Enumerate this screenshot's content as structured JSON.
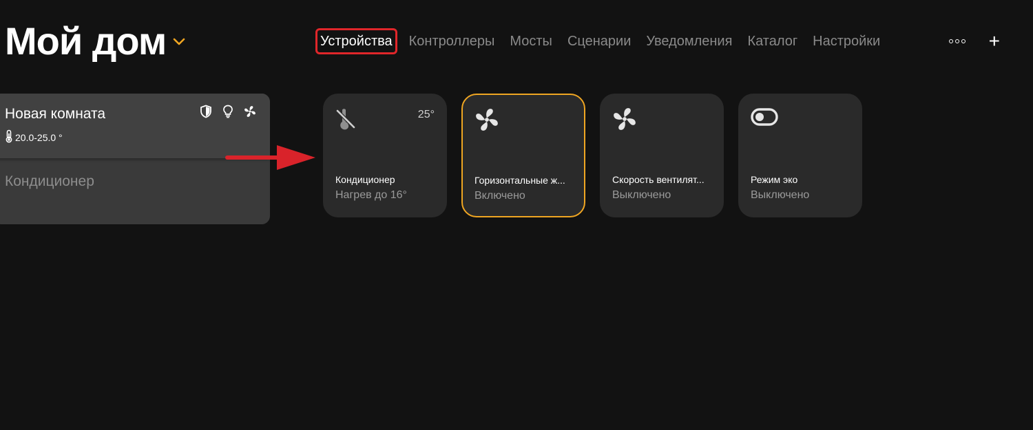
{
  "header": {
    "home_title": "Мой дом",
    "tabs": [
      {
        "label": "Устройства",
        "active": true
      },
      {
        "label": "Контроллеры"
      },
      {
        "label": "Мосты"
      },
      {
        "label": "Сценарии"
      },
      {
        "label": "Уведомления"
      },
      {
        "label": "Каталог"
      },
      {
        "label": "Настройки"
      }
    ],
    "plus_label": "+"
  },
  "room": {
    "name": "Новая комната",
    "temp_range": "20.0-25.0 °",
    "device_name": "Кондиционер",
    "icons": [
      "shield-icon",
      "bulb-icon",
      "fan-icon"
    ]
  },
  "tiles": [
    {
      "name": "Кондиционер",
      "state": "Нагрев до 16°",
      "temp": "25°",
      "icon": "ac-off-icon"
    },
    {
      "name": "Горизонтальные ж...",
      "state": "Включено",
      "icon": "fan-icon",
      "selected": true
    },
    {
      "name": "Скорость вентилят...",
      "state": "Выключено",
      "icon": "fan-icon"
    },
    {
      "name": "Режим эко",
      "state": "Выключено",
      "icon": "toggle-icon"
    }
  ],
  "colors": {
    "background": "#121212",
    "tile": "#2a2a2a",
    "accent_orange": "#f0a622",
    "highlight_red": "#e0262a"
  }
}
